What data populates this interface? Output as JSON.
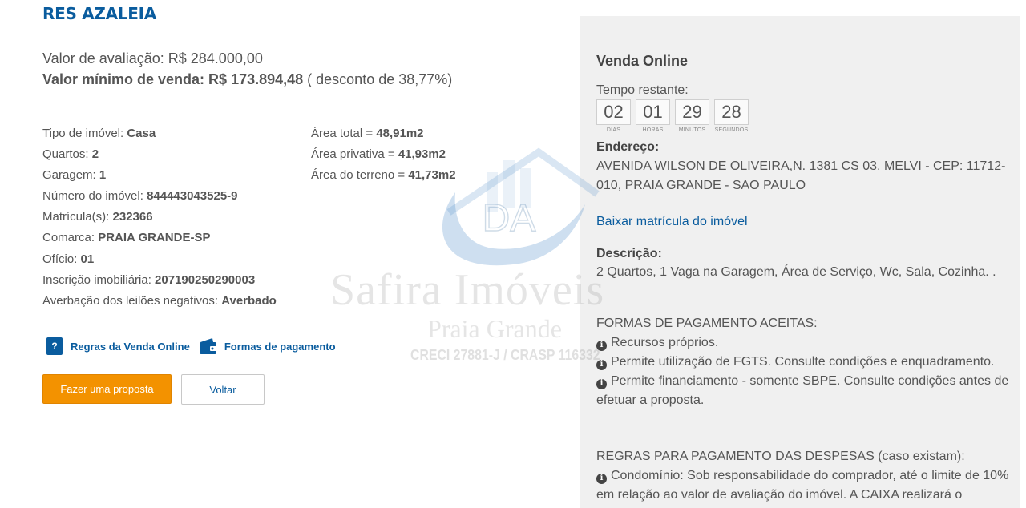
{
  "property": {
    "title": "RES AZALEIA",
    "valor_avaliacao": "Valor de avaliação: R$ 284.000,00",
    "valor_minimo_label": "Valor mínimo de venda: R$ 173.894,48",
    "desconto": " ( desconto de 38,77%)"
  },
  "details": [
    {
      "label": "Tipo de imóvel: ",
      "value": "Casa"
    },
    {
      "label": "Quartos: ",
      "value": "2"
    },
    {
      "label": "Garagem: ",
      "value": "1"
    },
    {
      "label": "Número do imóvel: ",
      "value": "844443043525-9"
    },
    {
      "label": "Matrícula(s): ",
      "value": "232366"
    },
    {
      "label": "Comarca: ",
      "value": "PRAIA GRANDE-SP"
    },
    {
      "label": "Ofício: ",
      "value": "01"
    },
    {
      "label": "Inscrição imobiliária: ",
      "value": "207190250290003"
    },
    {
      "label": "Averbação dos leilões negativos: ",
      "value": "Averbado"
    }
  ],
  "areas": [
    {
      "label": "Área total = ",
      "value": "48,91m2"
    },
    {
      "label": "Área privativa = ",
      "value": "41,93m2"
    },
    {
      "label": "Área do terreno = ",
      "value": "41,73m2"
    }
  ],
  "links": {
    "regras": "Regras da Venda Online",
    "formas": "Formas de pagamento",
    "question_icon_glyph": "?"
  },
  "buttons": {
    "proposta": "Fazer uma proposta",
    "voltar": "Voltar"
  },
  "watermark": {
    "logo_text": "DA",
    "name": "Safira Imóveis",
    "city": "Praia Grande",
    "creci": "CRECI 27881-J / CRASP 116332"
  },
  "panel": {
    "title": "Venda Online",
    "tempo_label": "Tempo restante:",
    "countdown": [
      {
        "value": "02",
        "label": "DIAS"
      },
      {
        "value": "01",
        "label": "HORAS"
      },
      {
        "value": "29",
        "label": "MINUTOS"
      },
      {
        "value": "28",
        "label": "SEGUNDOS"
      }
    ],
    "endereco_label": "Endereço:",
    "endereco": "AVENIDA WILSON DE OLIVEIRA,N. 1381 CS 03, MELVI - CEP: 11712-010, PRAIA GRANDE - SAO PAULO",
    "baixar_link": "Baixar matrícula do imóvel",
    "descricao_label": "Descrição:",
    "descricao": "2 Quartos, 1 Vaga na Garagem, Área de Serviço, Wc, Sala, Cozinha. .",
    "formas_title": "FORMAS DE PAGAMENTO ACEITAS:",
    "formas_items": [
      "Recursos próprios.",
      "Permite utilização de FGTS. Consulte condições e enquadramento.",
      "Permite financiamento - somente SBPE. Consulte condições antes de efetuar a proposta."
    ],
    "regras_title": "REGRAS PARA PAGAMENTO DAS DESPESAS (caso existam):",
    "regras_items": [
      "Condomínio: Sob responsabilidade do comprador, até o limite de 10% em relação ao valor de avaliação do imóvel. A CAIXA realizará o"
    ],
    "info_icon_glyph": "i"
  },
  "colors": {
    "brand_blue": "#0a5c9e",
    "accent_orange": "#f39200",
    "panel_bg": "#f0f0f0"
  }
}
